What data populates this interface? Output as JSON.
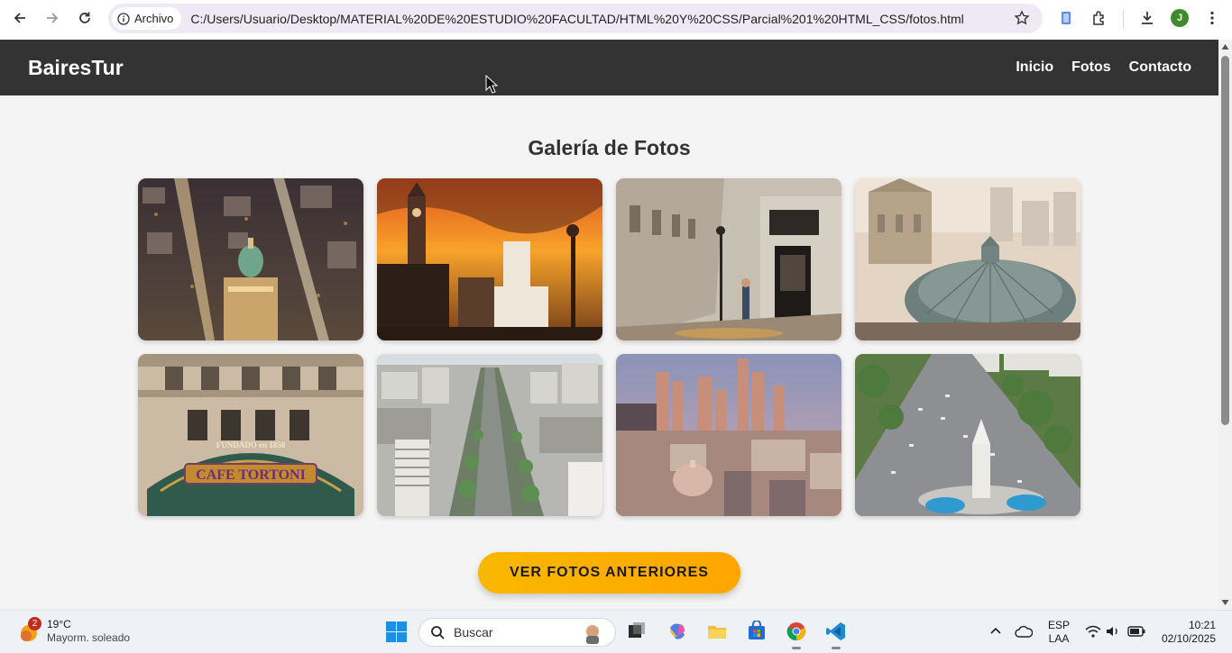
{
  "browser": {
    "site_chip_label": "Archivo",
    "url": "C:/Users/Usuario/Desktop/MATERIAL%20DE%20ESTUDIO%20FACULTAD/HTML%20Y%20CSS/Parcial%201%20HTML_CSS/fotos.html",
    "profile_initial": "J"
  },
  "site": {
    "logo": "BairesTur",
    "nav": [
      {
        "label": "Inicio"
      },
      {
        "label": "Fotos"
      },
      {
        "label": "Contacto"
      }
    ],
    "gallery_title": "Galería de Fotos",
    "photos": [
      {
        "icon": "night-city-aerial-photo"
      },
      {
        "icon": "sunset-cabildo-photo"
      },
      {
        "icon": "old-pharmacy-street-photo"
      },
      {
        "icon": "congress-dome-rooftops-photo"
      },
      {
        "icon": "cafe-tortoni-facade-photo"
      },
      {
        "icon": "avenue-aerial-photo"
      },
      {
        "icon": "city-skyline-photo"
      },
      {
        "icon": "monument-avenue-aerial-photo"
      }
    ],
    "cta_label": "VER FOTOS ANTERIORES",
    "cafe_sign_top": "FUNDADO en 1858",
    "cafe_sign_name": "CAFE TORTONI"
  },
  "taskbar": {
    "weather_badge": "2",
    "temperature": "19°C",
    "weather_desc": "Mayorm. soleado",
    "search_placeholder": "Buscar",
    "lang_line1": "ESP",
    "lang_line2": "LAA",
    "time": "10:21",
    "date": "02/10/2025"
  },
  "colors": {
    "header_bg": "#333333",
    "page_bg": "#f4f4f4",
    "cta_gradient_start": "#f9b800",
    "cta_gradient_end": "#ffa500",
    "profile_bg": "#3f8a2d"
  }
}
